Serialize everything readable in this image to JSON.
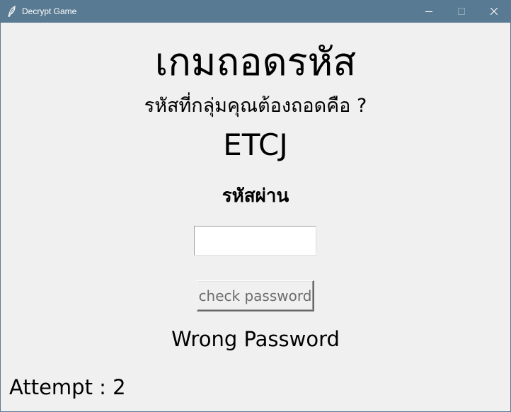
{
  "window": {
    "title": "Decrypt Game",
    "icon": "feather-icon",
    "controls": {
      "minimize": "minimize-icon",
      "maximize": "maximize-icon",
      "close": "close-icon"
    }
  },
  "main": {
    "heading": "เกมถอดรหัส",
    "question": "รหัสที่กลุ่มคุณต้องถอดคือ ?",
    "code": "ETCJ",
    "password_label": "รหัสผ่าน",
    "password_value": "",
    "check_button_label": "check password",
    "result_message": "Wrong Password",
    "attempt_text": "Attempt : 2"
  }
}
